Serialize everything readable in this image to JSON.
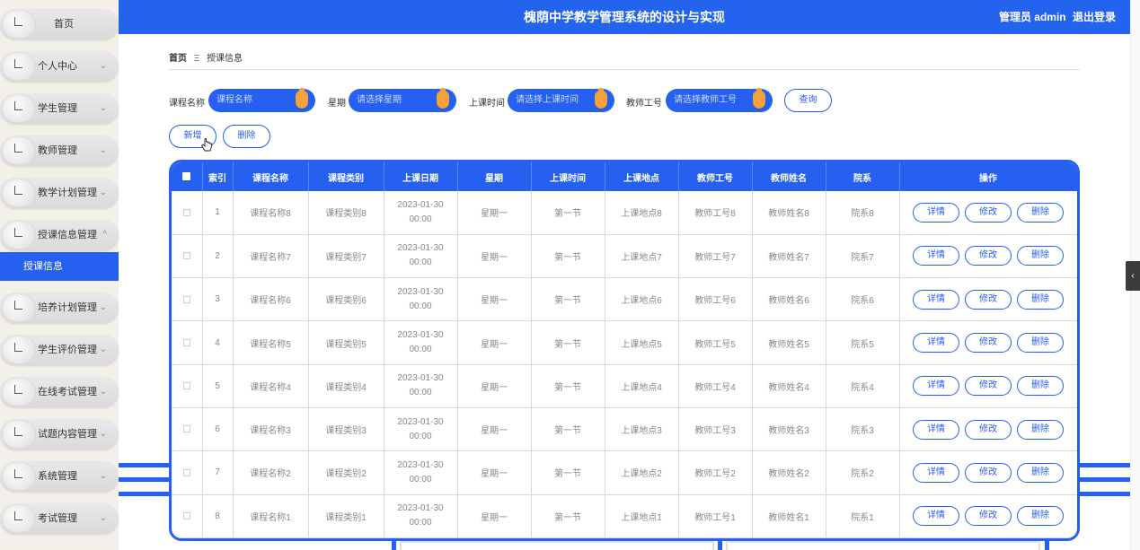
{
  "header": {
    "title": "槐荫中学教学管理系统的设计与实现",
    "user_label": "管理员 admin",
    "logout": "退出登录"
  },
  "sidebar": {
    "items": [
      {
        "label": "首页",
        "has_arrow": false
      },
      {
        "label": "个人中心",
        "has_arrow": true
      },
      {
        "label": "学生管理",
        "has_arrow": true
      },
      {
        "label": "教师管理",
        "has_arrow": true
      },
      {
        "label": "教学计划管理",
        "has_arrow": true
      },
      {
        "label": "授课信息管理",
        "has_arrow": true,
        "expanded": true
      },
      {
        "label": "培养计划管理",
        "has_arrow": true
      },
      {
        "label": "学生评价管理",
        "has_arrow": true
      },
      {
        "label": "在线考试管理",
        "has_arrow": true
      },
      {
        "label": "试题内容管理",
        "has_arrow": true
      },
      {
        "label": "系统管理",
        "has_arrow": true
      },
      {
        "label": "考试管理",
        "has_arrow": true
      }
    ],
    "active_sub": "授课信息"
  },
  "breadcrumb": {
    "home": "首页",
    "separator": "Ξ",
    "current": "授课信息"
  },
  "search": {
    "course_name_label": "课程名称",
    "course_name_placeholder": "课程名称",
    "weekday_label": "星期",
    "weekday_placeholder": "请选择星期",
    "time_label": "上课时间",
    "time_placeholder": "请选择上课时间",
    "teacher_id_label": "教师工号",
    "teacher_id_placeholder": "请选择教师工号",
    "query_button": "查询"
  },
  "actions": {
    "add_button": "新增",
    "delete_button": "删除"
  },
  "table": {
    "columns": [
      "索引",
      "课程名称",
      "课程类别",
      "上课日期",
      "星期",
      "上课时间",
      "上课地点",
      "教师工号",
      "教师姓名",
      "院系",
      "操作"
    ],
    "row_buttons": {
      "detail": "详情",
      "edit": "修改",
      "delete": "删除"
    },
    "rows": [
      {
        "index": "1",
        "course": "课程名称8",
        "category": "课程类别8",
        "date": "2023-01-30 00:00",
        "weekday": "星期一",
        "time": "第一节",
        "place": "上课地点8",
        "teacher_id": "教师工号8",
        "teacher_name": "教师姓名8",
        "dept": "院系8"
      },
      {
        "index": "2",
        "course": "课程名称7",
        "category": "课程类别7",
        "date": "2023-01-30 00:00",
        "weekday": "星期一",
        "time": "第一节",
        "place": "上课地点7",
        "teacher_id": "教师工号7",
        "teacher_name": "教师姓名7",
        "dept": "院系7"
      },
      {
        "index": "3",
        "course": "课程名称6",
        "category": "课程类别6",
        "date": "2023-01-30 00:00",
        "weekday": "星期一",
        "time": "第一节",
        "place": "上课地点6",
        "teacher_id": "教师工号6",
        "teacher_name": "教师姓名6",
        "dept": "院系6"
      },
      {
        "index": "4",
        "course": "课程名称5",
        "category": "课程类别5",
        "date": "2023-01-30 00:00",
        "weekday": "星期一",
        "time": "第一节",
        "place": "上课地点5",
        "teacher_id": "教师工号5",
        "teacher_name": "教师姓名5",
        "dept": "院系5"
      },
      {
        "index": "5",
        "course": "课程名称4",
        "category": "课程类别4",
        "date": "2023-01-30 00:00",
        "weekday": "星期一",
        "time": "第一节",
        "place": "上课地点4",
        "teacher_id": "教师工号4",
        "teacher_name": "教师姓名4",
        "dept": "院系4"
      },
      {
        "index": "6",
        "course": "课程名称3",
        "category": "课程类别3",
        "date": "2023-01-30 00:00",
        "weekday": "星期一",
        "time": "第一节",
        "place": "上课地点3",
        "teacher_id": "教师工号3",
        "teacher_name": "教师姓名3",
        "dept": "院系3"
      },
      {
        "index": "7",
        "course": "课程名称2",
        "category": "课程类别2",
        "date": "2023-01-30 00:00",
        "weekday": "星期一",
        "time": "第一节",
        "place": "上课地点2",
        "teacher_id": "教师工号2",
        "teacher_name": "教师姓名2",
        "dept": "院系2"
      },
      {
        "index": "8",
        "course": "课程名称1",
        "category": "课程类别1",
        "date": "2023-01-30 00:00",
        "weekday": "星期一",
        "time": "第一节",
        "place": "上课地点1",
        "teacher_id": "教师工号1",
        "teacher_name": "教师姓名1",
        "dept": "院系1"
      }
    ]
  },
  "colors": {
    "primary": "#2463ee",
    "knob": "#f4a23c",
    "sidebar_bg": "#f3efe9"
  }
}
